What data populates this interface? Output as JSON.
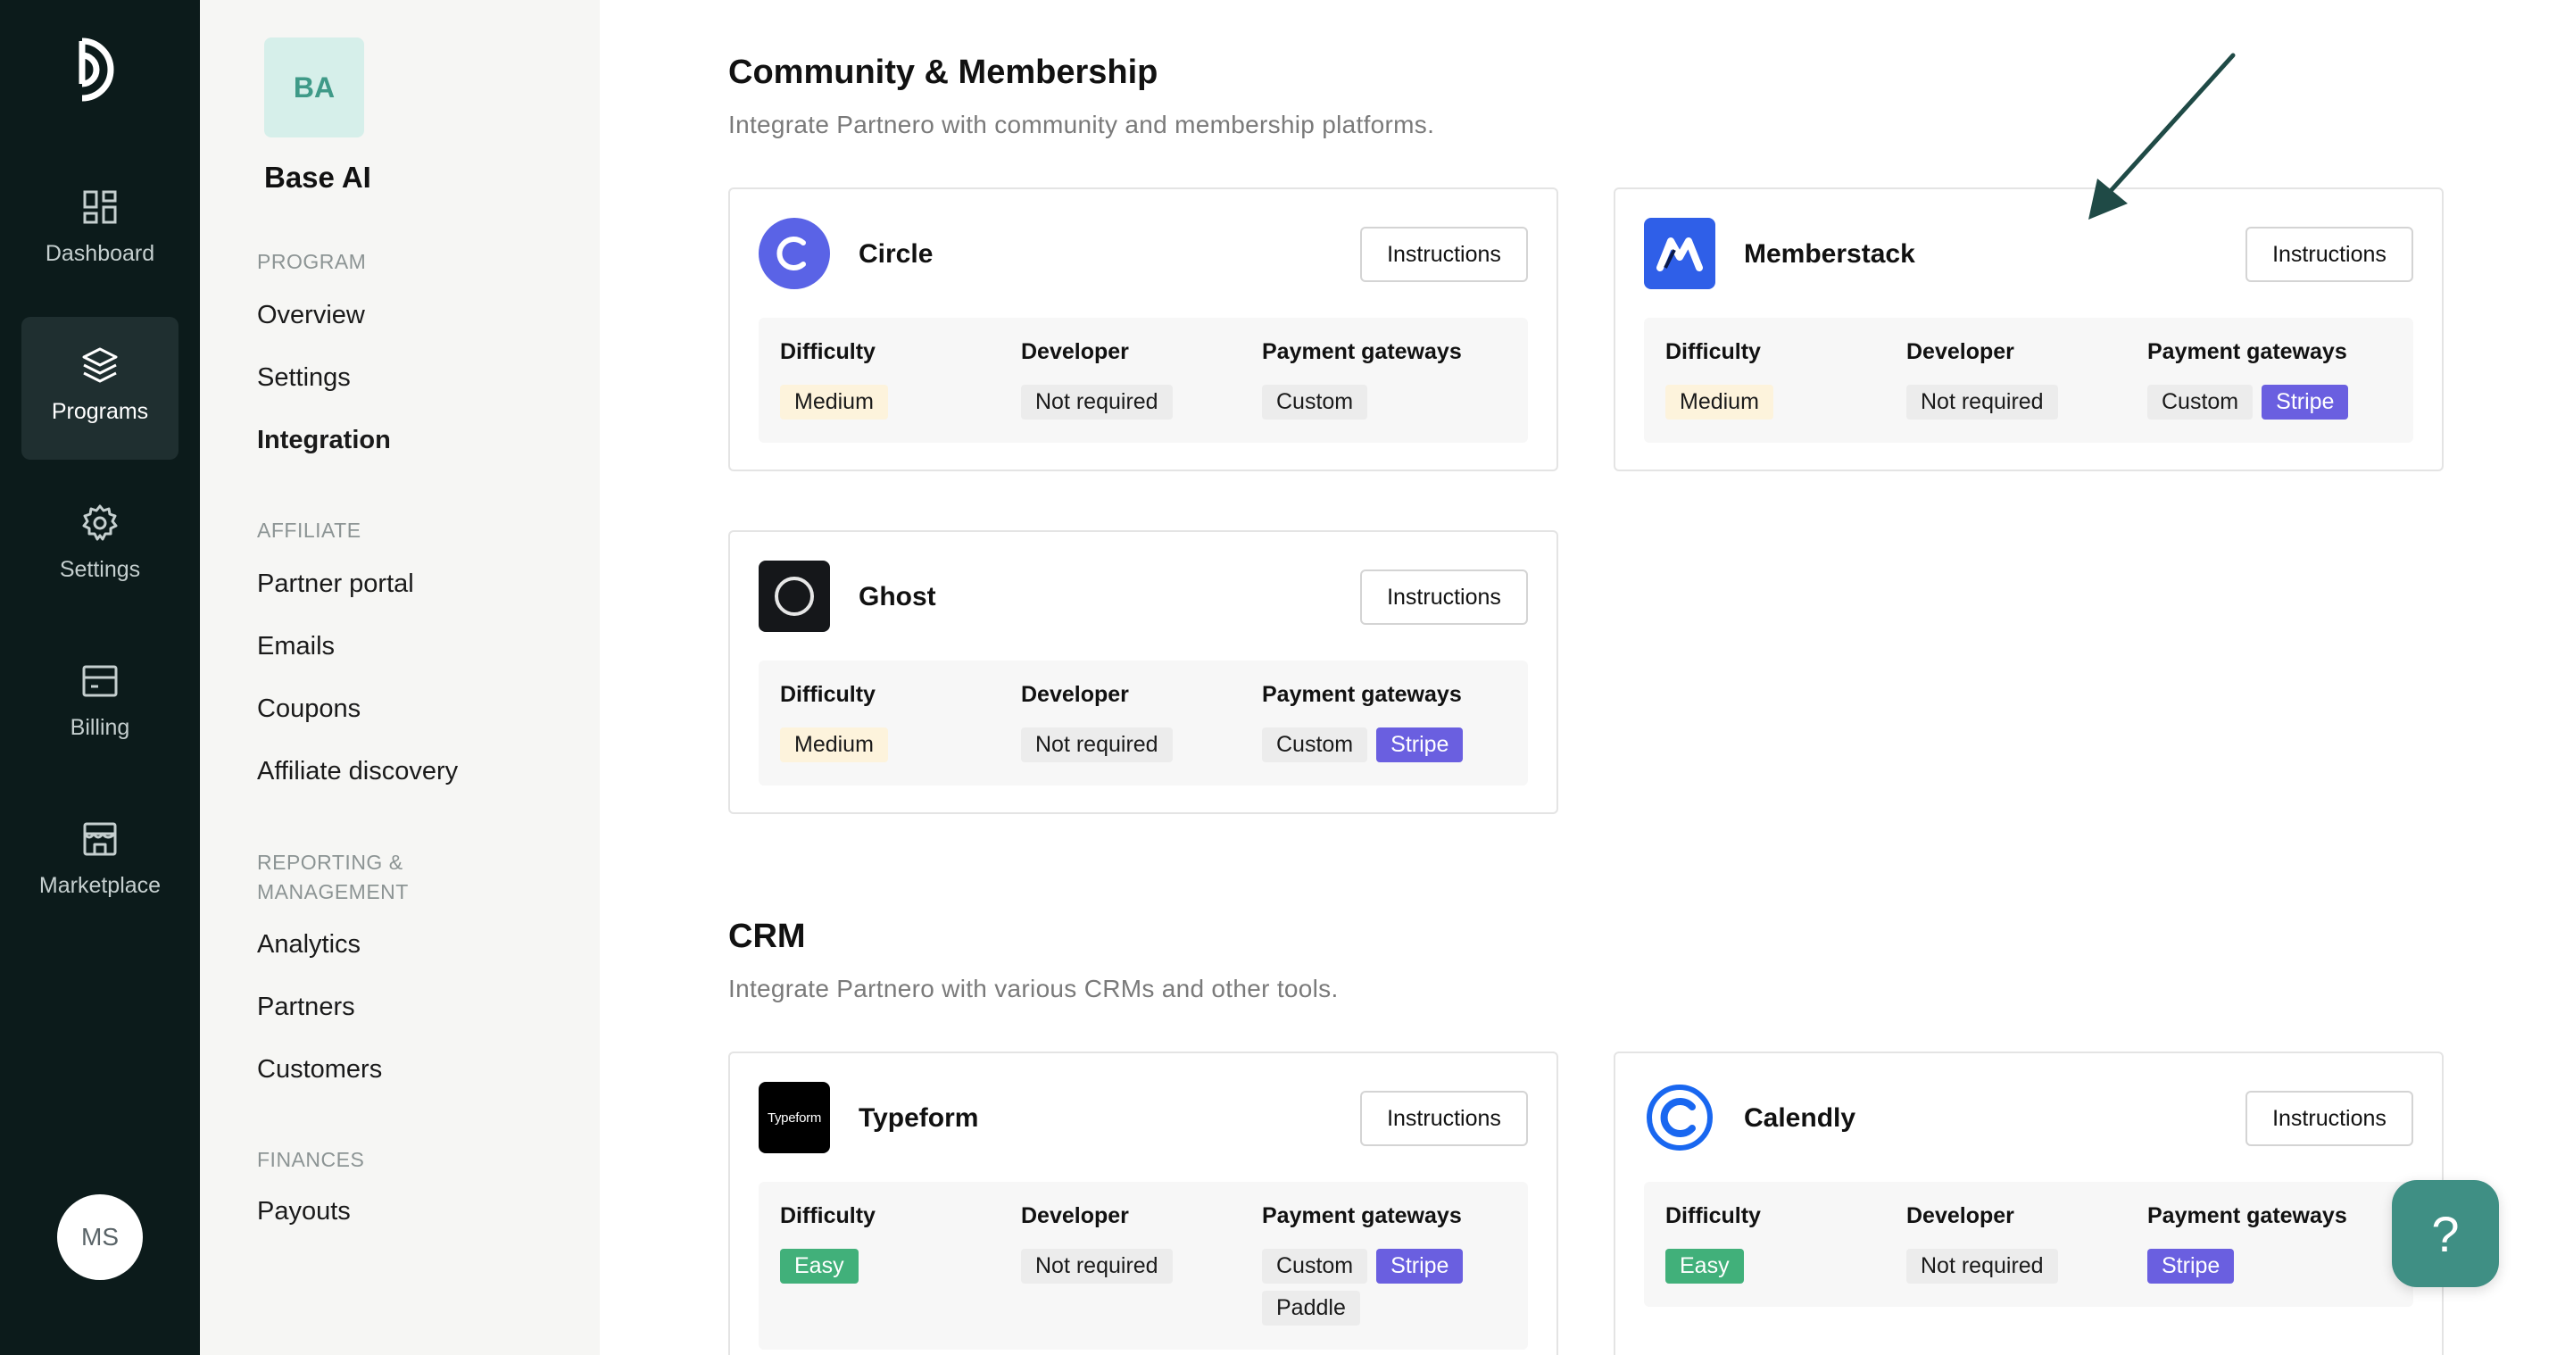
{
  "rail": {
    "items": [
      {
        "label": "Dashboard",
        "icon": "dashboard-icon"
      },
      {
        "label": "Programs",
        "icon": "layers-icon",
        "active": true
      },
      {
        "label": "Settings",
        "icon": "gear-icon"
      },
      {
        "label": "Billing",
        "icon": "billing-icon"
      },
      {
        "label": "Marketplace",
        "icon": "store-icon"
      }
    ],
    "user_initials": "MS"
  },
  "subnav": {
    "org_initials": "BA",
    "org_name": "Base AI",
    "sections": [
      {
        "title": "PROGRAM",
        "items": [
          "Overview",
          "Settings",
          "Integration"
        ]
      },
      {
        "title": "AFFILIATE",
        "items": [
          "Partner portal",
          "Emails",
          "Coupons",
          "Affiliate discovery"
        ]
      },
      {
        "title": "REPORTING & MANAGEMENT",
        "items": [
          "Analytics",
          "Partners",
          "Customers"
        ]
      },
      {
        "title": "FINANCES",
        "items": [
          "Payouts"
        ]
      }
    ],
    "active_item": "Integration"
  },
  "labels": {
    "instructions": "Instructions",
    "difficulty": "Difficulty",
    "developer": "Developer",
    "payment_gateways": "Payment gateways"
  },
  "community": {
    "title": "Community & Membership",
    "description": "Integrate Partnero with community and membership platforms.",
    "cards": [
      {
        "name": "Circle",
        "difficulty": "Medium",
        "developer": "Not required",
        "gateways": [
          "Custom"
        ],
        "logo": "circle-logo-icon"
      },
      {
        "name": "Memberstack",
        "difficulty": "Medium",
        "developer": "Not required",
        "gateways": [
          "Custom",
          "Stripe"
        ],
        "logo": "memberstack-logo-icon"
      },
      {
        "name": "Ghost",
        "difficulty": "Medium",
        "developer": "Not required",
        "gateways": [
          "Custom",
          "Stripe"
        ],
        "logo": "ghost-logo-icon"
      }
    ]
  },
  "crm": {
    "title": "CRM",
    "description": "Integrate Partnero with various CRMs and other tools.",
    "cards": [
      {
        "name": "Typeform",
        "logo_text": "Typeform",
        "difficulty": "Easy",
        "developer": "Not required",
        "gateways": [
          "Custom",
          "Stripe",
          "Paddle"
        ],
        "logo": "typeform-logo-icon"
      },
      {
        "name": "Calendly",
        "difficulty": "Easy",
        "developer": "Not required",
        "gateways": [
          "Stripe"
        ],
        "logo": "calendly-logo-icon"
      }
    ]
  },
  "help": {
    "glyph": "?"
  },
  "colors": {
    "rail_bg": "#0c1b1b",
    "accent": "#3f8f84",
    "stripe": "#6a5fe0",
    "easy": "#41b07a",
    "medium_bg": "#fdf3dc"
  }
}
